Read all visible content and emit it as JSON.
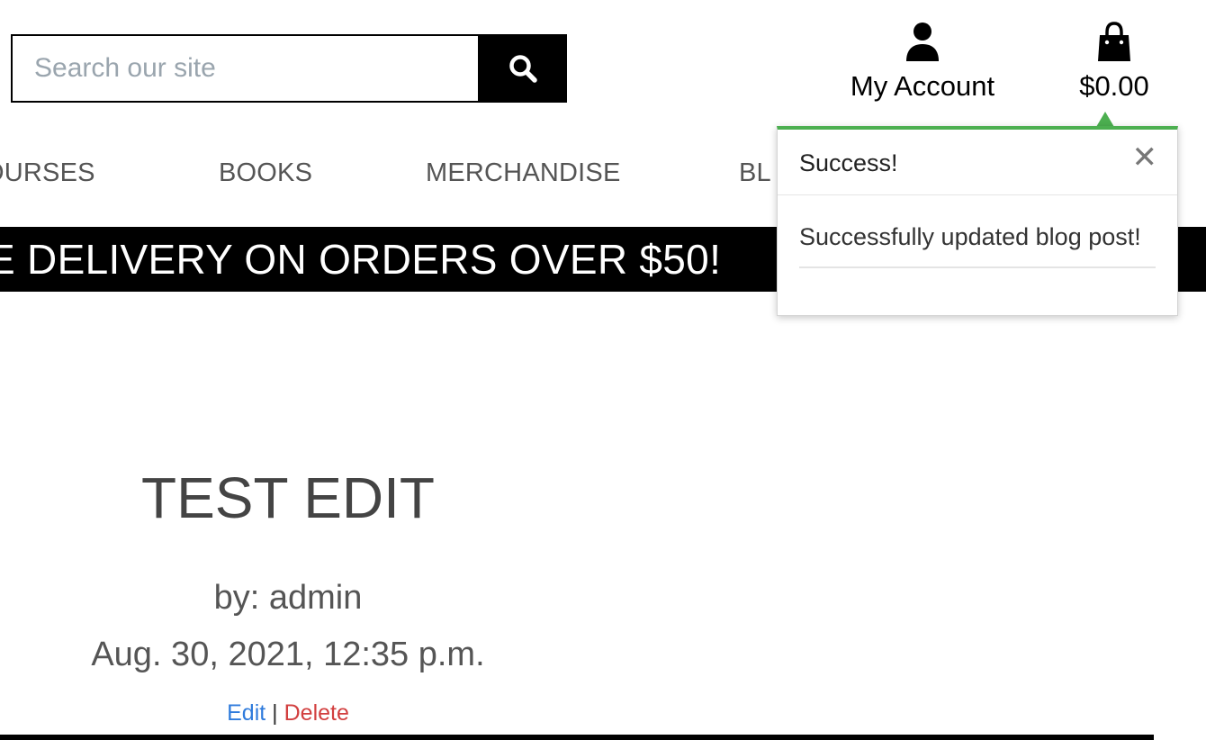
{
  "search": {
    "placeholder": "Search our site",
    "value": "",
    "icon": "search-icon"
  },
  "header": {
    "account": {
      "label": "My Account",
      "icon": "user-icon"
    },
    "cart": {
      "total": "$0.00",
      "icon": "shopping-bag-icon"
    }
  },
  "nav": {
    "items": [
      {
        "label": "OURSES"
      },
      {
        "label": "BOOKS"
      },
      {
        "label": "MERCHANDISE"
      },
      {
        "label": "BL"
      }
    ]
  },
  "banner": {
    "text": "E DELIVERY ON ORDERS OVER $50!"
  },
  "toast": {
    "title": "Success!",
    "close_icon": "close-icon",
    "message": "Successfully updated blog post!",
    "accent_color": "#4caf50"
  },
  "post": {
    "title": "TEST EDIT",
    "author": "by: admin",
    "date": "Aug. 30, 2021, 12:35 p.m.",
    "edit_label": "Edit",
    "separator": "|",
    "delete_label": "Delete"
  },
  "colors": {
    "link": "#2f7bdc",
    "danger": "#d23f3f",
    "banner_bg": "#000000"
  }
}
